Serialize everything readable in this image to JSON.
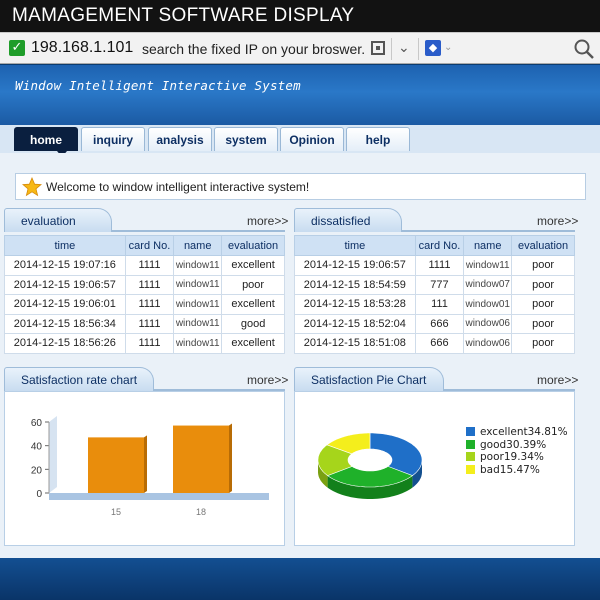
{
  "title": "MAMAGEMENT SOFTWARE DISPLAY",
  "browser": {
    "ip": "198.168.1.101",
    "hint": "search the fixed IP on your broswer."
  },
  "app": {
    "system_name": "Window Intelligent Interactive System"
  },
  "nav": {
    "tabs": [
      {
        "label": "home",
        "active": true
      },
      {
        "label": "inquiry"
      },
      {
        "label": "analysis"
      },
      {
        "label": "system"
      },
      {
        "label": "Opinion"
      },
      {
        "label": "help"
      }
    ]
  },
  "welcome": "Welcome to window intelligent interactive system!",
  "evaluation": {
    "title": "evaluation",
    "more": "more>>",
    "columns": [
      "time",
      "card No.",
      "name",
      "evaluation"
    ],
    "rows": [
      [
        "2014-12-15 19:07:16",
        "1111",
        "window11",
        "excellent"
      ],
      [
        "2014-12-15 19:06:57",
        "1111",
        "window11",
        "poor"
      ],
      [
        "2014-12-15 19:06:01",
        "1111",
        "window11",
        "excellent"
      ],
      [
        "2014-12-15 18:56:34",
        "1111",
        "window11",
        "good"
      ],
      [
        "2014-12-15 18:56:26",
        "1111",
        "window11",
        "excellent"
      ]
    ]
  },
  "dissatisfied": {
    "title": "dissatisfied",
    "more": "more>>",
    "columns": [
      "time",
      "card No.",
      "name",
      "evaluation"
    ],
    "rows": [
      [
        "2014-12-15 19:06:57",
        "1111",
        "window11",
        "poor"
      ],
      [
        "2014-12-15 18:54:59",
        "777",
        "window07",
        "poor"
      ],
      [
        "2014-12-15 18:53:28",
        "111",
        "window01",
        "poor"
      ],
      [
        "2014-12-15 18:52:04",
        "666",
        "window06",
        "poor"
      ],
      [
        "2014-12-15 18:51:08",
        "666",
        "window06",
        "poor"
      ]
    ]
  },
  "rate_chart": {
    "title": "Satisfaction rate chart",
    "more": "more>>"
  },
  "pie_chart": {
    "title": "Satisfaction Pie Chart",
    "more": "more>>"
  },
  "chart_data": [
    {
      "type": "bar",
      "categories": [
        "15",
        "18"
      ],
      "values": [
        47,
        57
      ],
      "ylim": [
        0,
        60
      ],
      "yticks": [
        "0",
        "20",
        "40",
        "60"
      ],
      "colors": {
        "bar": "#e98d0c",
        "floor": "#a9c4e2"
      }
    },
    {
      "type": "pie",
      "labels": [
        "excellent",
        "good",
        "poor",
        "bad"
      ],
      "values": [
        34.81,
        30.39,
        19.34,
        15.47
      ],
      "legend": [
        "excellent34.81%",
        "good30.39%",
        "poor19.34%",
        "bad15.47%"
      ],
      "colors": [
        "#1f6fc8",
        "#1fb12a",
        "#a6d51b",
        "#f4ee1c"
      ]
    }
  ]
}
